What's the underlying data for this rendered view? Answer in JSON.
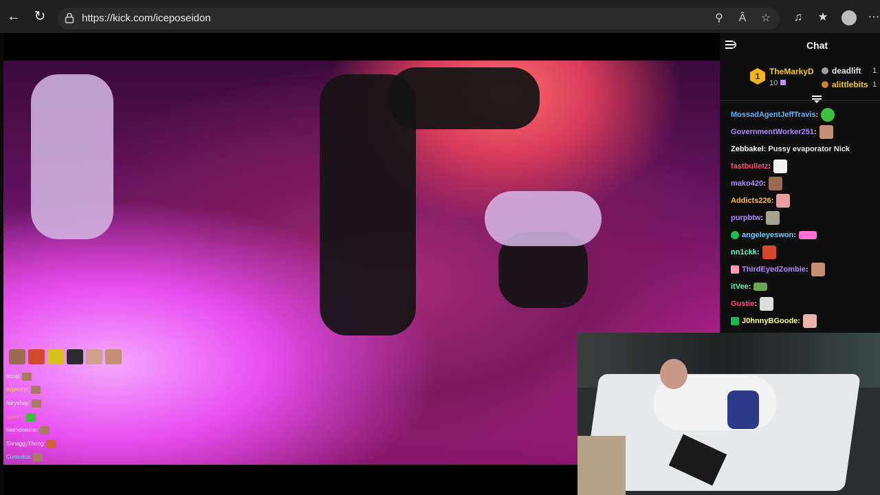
{
  "browser": {
    "url": "https://kick.com/iceposeidon",
    "icons": [
      "back-icon",
      "refresh-icon",
      "lock-icon",
      "zoom-icon",
      "read-aloud-icon",
      "favorite-star-icon",
      "extensions-icon",
      "favorites-icon",
      "profile-icon",
      "more-icon"
    ]
  },
  "chat": {
    "title": "Chat",
    "leaderboard": {
      "top": {
        "rank": "1",
        "name": "TheMarkyD",
        "count": "10"
      },
      "others": [
        {
          "name": "deadlift",
          "count": "1",
          "color": "#e6e6e6"
        },
        {
          "name": "alittlebits",
          "count": "1",
          "color": "#f5c518"
        }
      ]
    },
    "messages": [
      {
        "user": "MossadAgentJeffTravis",
        "color": "#64b5f6",
        "text": "",
        "emote": "#3fbf3f"
      },
      {
        "user": "GovernmentWorker251",
        "color": "#b388ff",
        "text": "",
        "emote": "#c48f72"
      },
      {
        "user": "Zebbakel",
        "color": "#ffffff",
        "text": "Pussy evaporator Nick",
        "emote": ""
      },
      {
        "user": "fastbulletz",
        "color": "#ff4d6d",
        "text": "",
        "emote": "#f2f2f2"
      },
      {
        "user": "mako420",
        "color": "#b388ff",
        "text": "",
        "emote": "#9c6b52"
      },
      {
        "user": "Addicts226",
        "color": "#ffb74d",
        "text": "",
        "emote": "#e8a0a0"
      },
      {
        "user": "purpbtw",
        "color": "#b388ff",
        "text": "",
        "emote": "#a7a38e"
      },
      {
        "user": "angeleyeswon",
        "color": "#64d2ff",
        "text": "",
        "emote": "#ff6fd8"
      },
      {
        "user": "nn1ckk",
        "color": "#64ffda",
        "text": "",
        "emote": "#d9482b"
      },
      {
        "user": "ThirdEyedZombie",
        "color": "#b388ff",
        "text": "",
        "emote": "#c48f72"
      },
      {
        "user": "itVee",
        "color": "#69f0ae",
        "text": "",
        "emote": "#6aa84f"
      },
      {
        "user": "Gustie",
        "color": "#ff4d6d",
        "text": "",
        "emote": "#dddddd"
      },
      {
        "user": "J0hnnyBGoode",
        "color": "#ffff8d",
        "text": "",
        "emote": "#e8b4a8"
      }
    ]
  },
  "overlay_chat": {
    "lines": [
      {
        "user": "tlcoal:",
        "color": "#ffe0ff"
      },
      {
        "user": "hypnocyl:",
        "color": "#ffd54f"
      },
      {
        "user": "fairyebay:",
        "color": "#ffe0ff"
      },
      {
        "user": "xpedr7:",
        "color": "#ff8a80"
      },
      {
        "user": "heehoheeho:",
        "color": "#ffe0ff"
      },
      {
        "user": "ShnaggyThong:",
        "color": "#ffe0ff"
      },
      {
        "user": "Cunicolus:",
        "color": "#80d8ff"
      }
    ]
  }
}
